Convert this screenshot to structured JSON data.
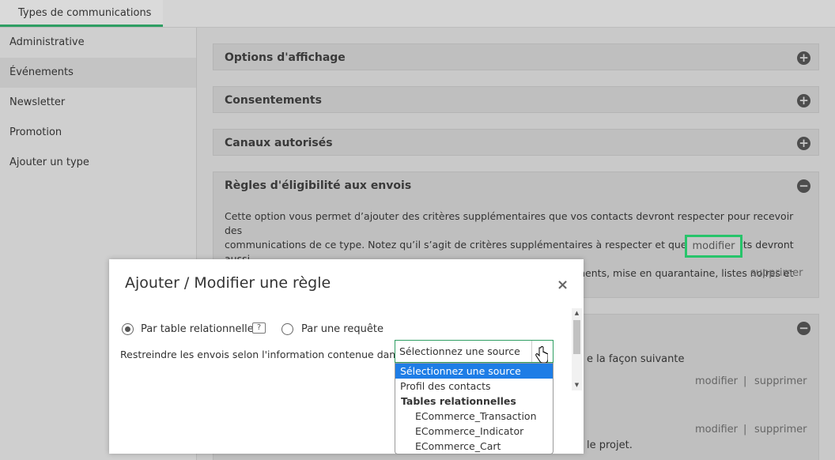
{
  "tabbar": {
    "active_tab": "Types de communications"
  },
  "sidebar": {
    "items": [
      {
        "label": "Administrative"
      },
      {
        "label": "Événements"
      },
      {
        "label": "Newsletter"
      },
      {
        "label": "Promotion"
      },
      {
        "label": "Ajouter un type"
      }
    ]
  },
  "panels": {
    "display_options": {
      "title": "Options d'affichage",
      "icon": "plus-circle-icon"
    },
    "consents": {
      "title": "Consentements",
      "icon": "plus-circle-icon"
    },
    "channels": {
      "title": "Canaux autorisés",
      "icon": "plus-circle-icon"
    },
    "eligibility": {
      "title": "Règles d'éligibilité aux envois",
      "icon": "minus-circle-icon",
      "description_line1": "Cette option vous permet d’ajouter des critères supplémentaires que vos contacts devront respecter pour recevoir des",
      "description_line2": "communications de ce type. Notez qu’il s’agit de critères supplémentaires à respecter et que vos contacts devront aussi",
      "description_line3": "respecter toutes les règles normales vis-à-vis de leur statuts, consentements, mise en quarantaine, listes noires et autres.",
      "modify_label": "modifier",
      "delete_label": "supprimer"
    },
    "next": {
      "icon": "minus-circle-icon",
      "partial_text": "e la façon suivante",
      "modify_label": "modifier",
      "separator": "|",
      "delete_label": "supprimer",
      "modify_label_2": "modifier",
      "separator_2": "|",
      "delete_label_2": "supprimer",
      "partial_text_2": "le projet.",
      "button_partial": "r"
    }
  },
  "modal": {
    "title": "Ajouter / Modifier une règle",
    "close_symbol": "×",
    "radio_table_label": "Par table relationnelle",
    "radio_query_label": "Par une requête",
    "help_symbol": "?",
    "restrict_label": "Restreindre les envois selon l'information contenue dans",
    "select_value": "Sélectionnez une source",
    "scroll_up": "▲",
    "scroll_down": "▼"
  },
  "dropdown": {
    "options": [
      "Sélectionnez une source",
      "Profil des contacts"
    ],
    "group_label": "Tables relationnelles",
    "sub_options": [
      "ECommerce_Transaction",
      "ECommerce_Indicator",
      "ECommerce_Cart"
    ]
  },
  "colors": {
    "accent_green": "#2f9e63",
    "highlight_green": "#27c46a",
    "selected_blue": "#1e7de6"
  }
}
